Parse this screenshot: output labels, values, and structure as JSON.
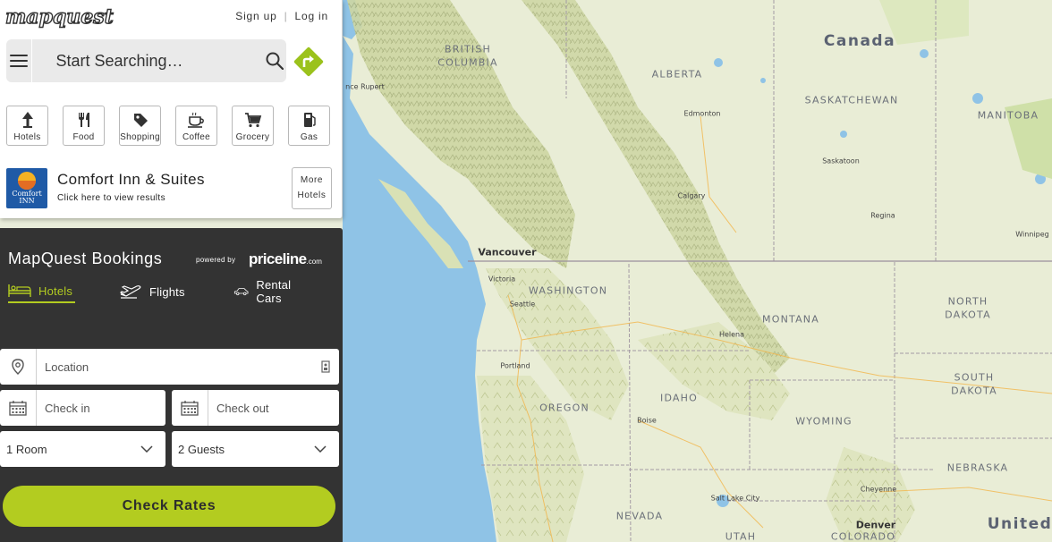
{
  "header": {
    "logo_text": "mapquest",
    "sign_up": "Sign up",
    "log_in": "Log in"
  },
  "search": {
    "placeholder": "Start Searching…"
  },
  "categories": [
    {
      "label": "Hotels",
      "icon": "hotel-icon"
    },
    {
      "label": "Food",
      "icon": "fork-knife-icon"
    },
    {
      "label": "Shopping",
      "icon": "tag-icon"
    },
    {
      "label": "Coffee",
      "icon": "coffee-cup-icon"
    },
    {
      "label": "Grocery",
      "icon": "shopping-cart-icon"
    },
    {
      "label": "Gas",
      "icon": "gas-pump-icon"
    }
  ],
  "ad": {
    "logo_line1": "Comfort",
    "logo_line2": "INN",
    "title": "Comfort Inn & Suites",
    "subtitle": "Click here to view results",
    "more_line1": "More",
    "more_line2": "Hotels"
  },
  "bookings": {
    "title": "MapQuest Bookings",
    "powered_by": "powered by",
    "partner": "priceline",
    "partner_suffix": ".com",
    "tabs": [
      {
        "label": "Hotels",
        "active": true
      },
      {
        "label": "Flights",
        "active": false
      },
      {
        "label": "Rental Cars",
        "active": false
      }
    ],
    "location_placeholder": "Location",
    "checkin_placeholder": "Check in",
    "checkout_placeholder": "Check out",
    "rooms_value": "1 Room",
    "guests_value": "2 Guests",
    "submit_label": "Check Rates"
  },
  "map": {
    "labels": {
      "canada": "Canada",
      "british_columbia_1": "BRITISH",
      "british_columbia_2": "COLUMBIA",
      "alberta": "ALBERTA",
      "saskatchewan": "SASKATCHEWAN",
      "manitoba": "MANITOBA",
      "prince_rupert": "nce Rupert",
      "edmonton": "Edmonton",
      "saskatoon": "Saskatoon",
      "calgary": "Calgary",
      "regina": "Regina",
      "winnipeg": "Winnipeg",
      "vancouver": "Vancouver",
      "victoria": "Victoria",
      "washington": "WASHINGTON",
      "seattle": "Seattle",
      "montana": "MONTANA",
      "north_dakota_1": "NORTH",
      "north_dakota_2": "DAKOTA",
      "helena": "Helena",
      "portland": "Portland",
      "idaho": "IDAHO",
      "oregon": "OREGON",
      "south_dakota_1": "SOUTH",
      "south_dakota_2": "DAKOTA",
      "boise": "Boise",
      "wyoming": "WYOMING",
      "nebraska": "NEBRASKA",
      "salt_lake_city": "Salt Lake City",
      "cheyenne": "Cheyenne",
      "nevada": "NEVADA",
      "denver": "Denver",
      "utah": "UTAH",
      "colorado": "COLORADO",
      "united": "United"
    },
    "colors": {
      "land": "#e9edd6",
      "water": "#8fc3e6",
      "mountains": "#c8d19a",
      "borders": "#a49aa4"
    }
  },
  "colors": {
    "accent": "#b3cc20",
    "panel_dark": "#333333",
    "directions_green": "#9bc21c"
  }
}
